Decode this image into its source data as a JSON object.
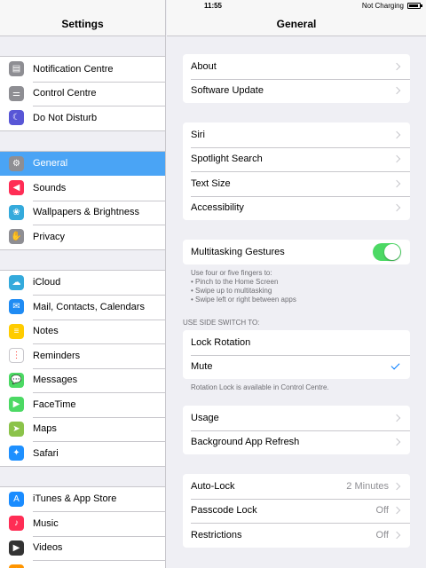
{
  "status_bar": {
    "time": "11:55",
    "battery_text": "Not Charging"
  },
  "master": {
    "title": "Settings",
    "groups": [
      [
        {
          "label": "Notification Centre",
          "icon": "notification-centre-icon",
          "color": "#8e8e93",
          "glyph": "▤"
        },
        {
          "label": "Control Centre",
          "icon": "control-centre-icon",
          "color": "#8e8e93",
          "glyph": "⚌"
        },
        {
          "label": "Do Not Disturb",
          "icon": "moon-icon",
          "color": "#5856d6",
          "glyph": "☾"
        }
      ],
      [
        {
          "label": "General",
          "icon": "gear-icon",
          "color": "#8e8e93",
          "glyph": "⚙",
          "selected": true
        },
        {
          "label": "Sounds",
          "icon": "speaker-icon",
          "color": "#ff2d55",
          "glyph": "◀"
        },
        {
          "label": "Wallpapers & Brightness",
          "icon": "flower-icon",
          "color": "#34aadc",
          "glyph": "❀"
        },
        {
          "label": "Privacy",
          "icon": "hand-icon",
          "color": "#8e8e93",
          "glyph": "✋"
        }
      ],
      [
        {
          "label": "iCloud",
          "icon": "cloud-icon",
          "color": "#34aadc",
          "glyph": "☁"
        },
        {
          "label": "Mail, Contacts, Calendars",
          "icon": "mail-icon",
          "color": "#1f8bf3",
          "glyph": "✉"
        },
        {
          "label": "Notes",
          "icon": "notes-icon",
          "color": "#ffcc00",
          "glyph": "≡"
        },
        {
          "label": "Reminders",
          "icon": "reminders-icon",
          "color": "#ffffff",
          "glyph": "⋮"
        },
        {
          "label": "Messages",
          "icon": "messages-icon",
          "color": "#4cd964",
          "glyph": "💬"
        },
        {
          "label": "FaceTime",
          "icon": "facetime-icon",
          "color": "#4cd964",
          "glyph": "▶"
        },
        {
          "label": "Maps",
          "icon": "maps-icon",
          "color": "#8bc34a",
          "glyph": "➤"
        },
        {
          "label": "Safari",
          "icon": "safari-icon",
          "color": "#1e90ff",
          "glyph": "✦"
        }
      ],
      [
        {
          "label": "iTunes & App Store",
          "icon": "app-store-icon",
          "color": "#1a8cff",
          "glyph": "A"
        },
        {
          "label": "Music",
          "icon": "music-icon",
          "color": "#ff2d55",
          "glyph": "♪"
        },
        {
          "label": "Videos",
          "icon": "videos-icon",
          "color": "#333333",
          "glyph": "▶"
        },
        {
          "label": "Photos & Camera",
          "icon": "photos-icon",
          "color": "#ff9500",
          "glyph": "✿"
        }
      ]
    ]
  },
  "detail": {
    "title": "General",
    "card1": [
      {
        "label": "About"
      },
      {
        "label": "Software Update"
      }
    ],
    "card2": [
      {
        "label": "Siri"
      },
      {
        "label": "Spotlight Search"
      },
      {
        "label": "Text Size"
      },
      {
        "label": "Accessibility"
      }
    ],
    "multitasking": {
      "label": "Multitasking Gestures",
      "toggle_on": true,
      "note_lines": [
        "Use four or five fingers to:",
        "• Pinch to the Home Screen",
        "• Swipe up to multitasking",
        "• Swipe left or right between apps"
      ]
    },
    "side_switch": {
      "header": "USE SIDE SWITCH TO:",
      "options": [
        {
          "label": "Lock Rotation",
          "checked": false
        },
        {
          "label": "Mute",
          "checked": true
        }
      ],
      "note": "Rotation Lock is available in Control Centre."
    },
    "card4": [
      {
        "label": "Usage"
      },
      {
        "label": "Background App Refresh"
      }
    ],
    "card5": [
      {
        "label": "Auto-Lock",
        "value": "2 Minutes"
      },
      {
        "label": "Passcode Lock",
        "value": "Off"
      },
      {
        "label": "Restrictions",
        "value": "Off"
      }
    ]
  },
  "colors": {
    "accent": "#007aff",
    "selected_row": "#4aa4f5",
    "toggle_on": "#4cd964",
    "background": "#efeff4"
  }
}
